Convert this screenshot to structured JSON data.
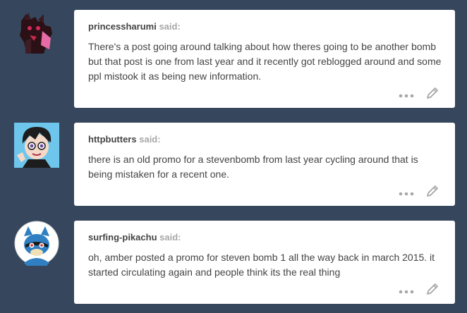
{
  "asks": [
    {
      "username": "princessharumi",
      "said_label": "said:",
      "message": "There's a post going around talking about how theres going to be another bomb but that post is one from last year and it recently got reblogged around and some ppl mistook it as being new information.",
      "avatar_icon": "dark-wolf-avatar-icon"
    },
    {
      "username": "httpbutters",
      "said_label": "said:",
      "message": "there is an old promo for a stevenbomb from last year cycling around that is being mistaken for a recent one.",
      "avatar_icon": "cartoon-boy-avatar-icon"
    },
    {
      "username": "surfing-pikachu",
      "said_label": "said:",
      "message": "oh, amber posted a promo for steven bomb 1 all the way back in march 2015. it started circulating again and people think its the real thing",
      "avatar_icon": "riolu-avatar-icon"
    }
  ],
  "colors": {
    "background": "#36465d",
    "card": "#ffffff",
    "username": "#444444",
    "said": "#a7a7a7",
    "message": "#444444",
    "controls": "#a7a7a7"
  },
  "icons": {
    "more": "more-dots-icon",
    "edit": "pencil-edit-icon"
  }
}
